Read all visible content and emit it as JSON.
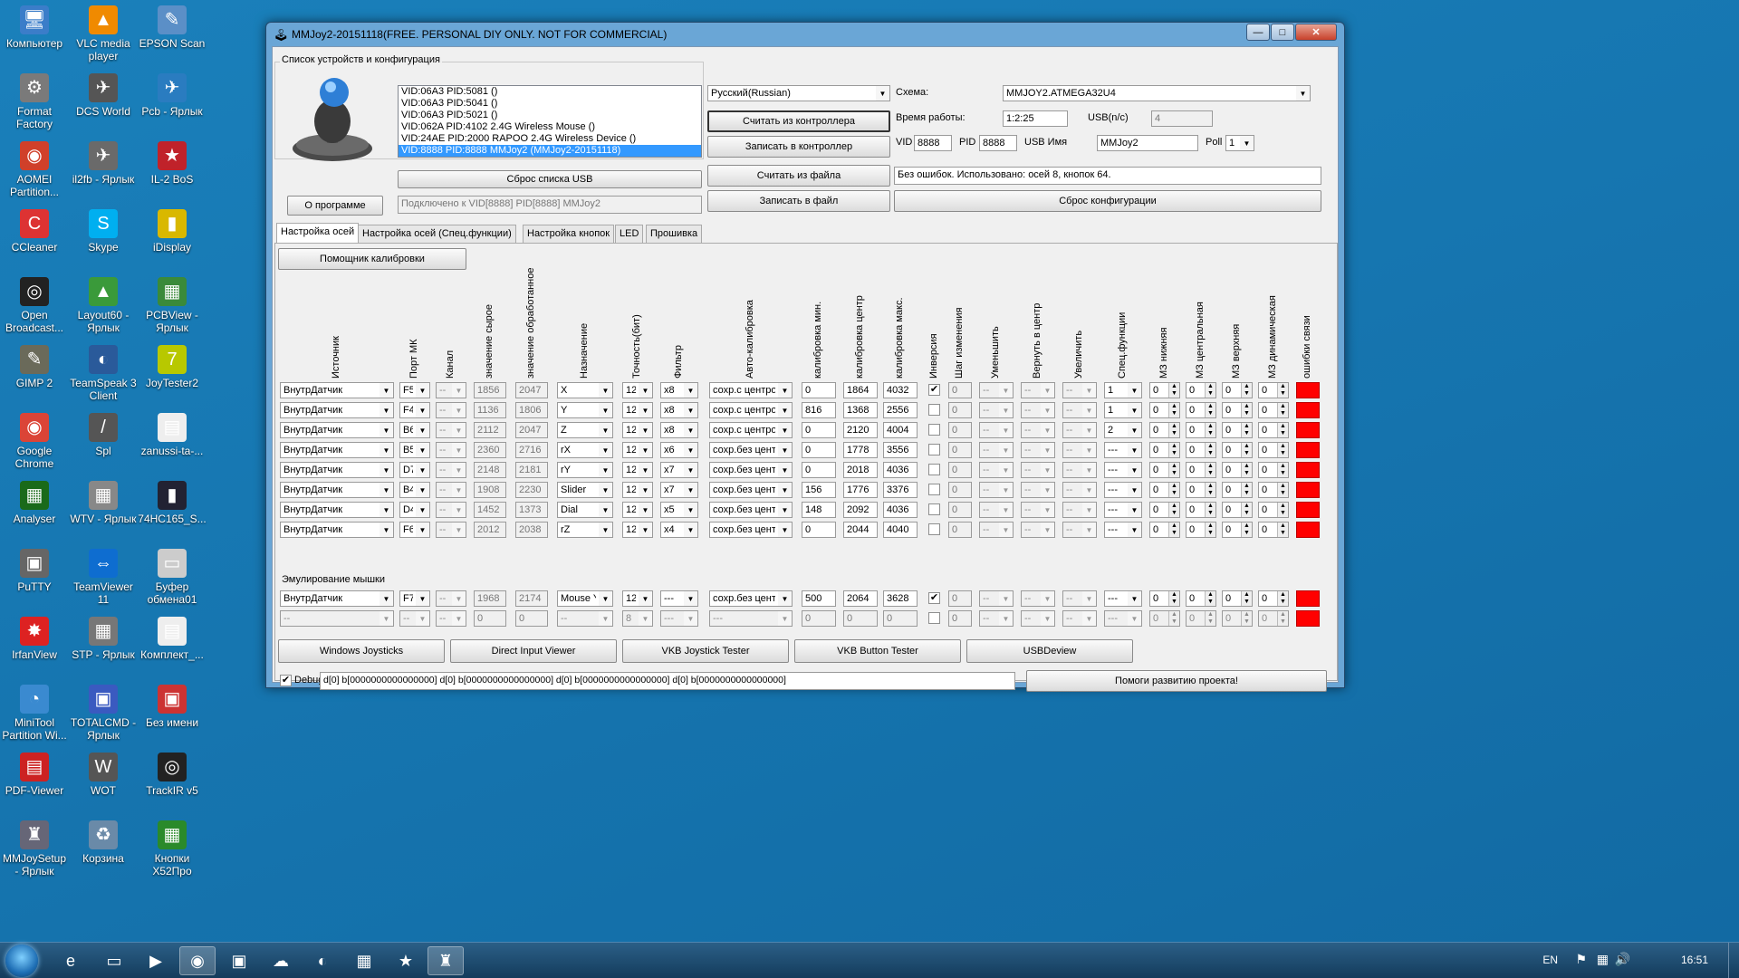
{
  "desktop_icons": [
    {
      "label": "Компьютер",
      "icon": "computer-icon",
      "glyph": "🖥",
      "color": "#3b7dc9"
    },
    {
      "label": "VLC media player",
      "icon": "vlc-icon",
      "glyph": "▲",
      "color": "#f08a00"
    },
    {
      "label": "EPSON Scan",
      "icon": "scanner-icon",
      "glyph": "✎",
      "color": "#5b8fc7"
    },
    {
      "label": "Format Factory",
      "icon": "format-factory-icon",
      "glyph": "⚙",
      "color": "#7a7a7a"
    },
    {
      "label": "DCS World",
      "icon": "dcs-icon",
      "glyph": "✈",
      "color": "#555"
    },
    {
      "label": "Pcb - Ярлык",
      "icon": "pcb-icon",
      "glyph": "✈",
      "color": "#2a7cc0"
    },
    {
      "label": "AOMEI Partition...",
      "icon": "aomei-icon",
      "glyph": "◉",
      "color": "#d0402a"
    },
    {
      "label": "il2fb - Ярлык",
      "icon": "il2fb-icon",
      "glyph": "✈",
      "color": "#6a6a6a"
    },
    {
      "label": "IL-2 BoS",
      "icon": "il2-bos-icon",
      "glyph": "★",
      "color": "#c0222a"
    },
    {
      "label": "CCleaner",
      "icon": "ccleaner-icon",
      "glyph": "C",
      "color": "#d33"
    },
    {
      "label": "Skype",
      "icon": "skype-icon",
      "glyph": "S",
      "color": "#00aff0"
    },
    {
      "label": "iDisplay",
      "icon": "idisplay-icon",
      "glyph": "▮",
      "color": "#d9b800"
    },
    {
      "label": "Open Broadcast...",
      "icon": "obs-icon",
      "glyph": "◎",
      "color": "#222"
    },
    {
      "label": "Layout60 - Ярлык",
      "icon": "layout-icon",
      "glyph": "▲",
      "color": "#3a9a3a"
    },
    {
      "label": "PCBView - Ярлык",
      "icon": "pcbview-icon",
      "glyph": "▦",
      "color": "#3a8a3a"
    },
    {
      "label": "GIMP 2",
      "icon": "gimp-icon",
      "glyph": "✎",
      "color": "#6a6a5a"
    },
    {
      "label": "TeamSpeak 3 Client",
      "icon": "teamspeak-icon",
      "glyph": "◐",
      "color": "#2a5a9a"
    },
    {
      "label": "JoyTester2",
      "icon": "joytester-icon",
      "glyph": "7",
      "color": "#b8c800"
    },
    {
      "label": "Google Chrome",
      "icon": "chrome-icon",
      "glyph": "◉",
      "color": "#db4437"
    },
    {
      "label": "Spl",
      "icon": "spl-icon",
      "glyph": "/",
      "color": "#555"
    },
    {
      "label": "zanussi-ta-...",
      "icon": "document-icon",
      "glyph": "▤",
      "color": "#eee"
    },
    {
      "label": "Analyser",
      "icon": "analyser-icon",
      "glyph": "▦",
      "color": "#1a6a1a"
    },
    {
      "label": "WTV - Ярлык",
      "icon": "wtv-icon",
      "glyph": "▦",
      "color": "#888"
    },
    {
      "label": "74HC165_S...",
      "icon": "chip-icon",
      "glyph": "▮",
      "color": "#223"
    },
    {
      "label": "PuTTY",
      "icon": "putty-icon",
      "glyph": "▣",
      "color": "#666"
    },
    {
      "label": "TeamViewer 11",
      "icon": "teamviewer-icon",
      "glyph": "⇔",
      "color": "#0e6dd0"
    },
    {
      "label": "Буфер обмена01",
      "icon": "clipboard-icon",
      "glyph": "▭",
      "color": "#ccc"
    },
    {
      "label": "IrfanView",
      "icon": "irfanview-icon",
      "glyph": "✸",
      "color": "#d22"
    },
    {
      "label": "STP - Ярлык",
      "icon": "stp-icon",
      "glyph": "▦",
      "color": "#777"
    },
    {
      "label": "Комплект_...",
      "icon": "document-icon",
      "glyph": "▤",
      "color": "#eee"
    },
    {
      "label": "MiniTool Partition Wi...",
      "icon": "minitool-icon",
      "glyph": "◔",
      "color": "#3a8ad0"
    },
    {
      "label": "TOTALCMD - Ярлык",
      "icon": "totalcmd-icon",
      "glyph": "▣",
      "color": "#3a5ac0"
    },
    {
      "label": "Без имени",
      "icon": "image-icon",
      "glyph": "▣",
      "color": "#c33"
    },
    {
      "label": "PDF-Viewer",
      "icon": "pdf-icon",
      "glyph": "▤",
      "color": "#c22"
    },
    {
      "label": "WOT",
      "icon": "wot-icon",
      "glyph": "W",
      "color": "#555"
    },
    {
      "label": "TrackIR v5",
      "icon": "trackir-icon",
      "glyph": "◎",
      "color": "#222"
    },
    {
      "label": "MMJoySetup - Ярлык",
      "icon": "joystick-icon",
      "glyph": "♜",
      "color": "#667"
    },
    {
      "label": "Корзина",
      "icon": "recycle-bin-icon",
      "glyph": "♻",
      "color": "#6a8aa8"
    },
    {
      "label": "Кнопки X52Про",
      "icon": "spreadsheet-icon",
      "glyph": "▦",
      "color": "#2a8a2a"
    }
  ],
  "window": {
    "title": "MMJoy2-20151118(FREE. PERSONAL DIY ONLY. NOT FOR COMMERCIAL)",
    "group_title": "Список устройств и конфигурация",
    "devices": [
      "VID:06A3 PID:5081  ()",
      "VID:06A3 PID:5041  ()",
      "VID:06A3 PID:5021  ()",
      "VID:062A PID:4102 2.4G Wireless Mouse ()",
      "VID:24AE PID:2000 RAPOO 2.4G Wireless Device ()",
      "VID:8888 PID:8888 MMJoy2 (MMJoy2-20151118)"
    ],
    "about_button": "О программе",
    "reset_usb_button": "Сброс списка USB",
    "connected_text": "Подключено к VID[8888] PID[8888] MMJoy2",
    "language": "Русский(Russian)",
    "read_controller": "Считать из контроллера",
    "write_controller": "Записать в контроллер",
    "read_file": "Считать из файла",
    "write_file": "Записать в файл",
    "scheme_label": "Схема:",
    "scheme_value": "MMJOY2.ATMEGA32U4",
    "uptime_label": "Время работы:",
    "uptime_value": "1:2:25",
    "usb_label": "USB(n/c)",
    "usb_value": "4",
    "vid_label": "VID",
    "vid_value": "8888",
    "pid_label": "PID",
    "pid_value": "8888",
    "usb_name_label": "USB Имя",
    "usb_name_value": "MMJoy2",
    "poll_label": "Poll",
    "poll_value": "1",
    "status_text": "Без ошибок. Использовано: осей  8, кнопок  64.",
    "reset_config_button": "Сброс конфигурации",
    "tabs": [
      "Настройка осей",
      "Настройка осей (Спец.функции)",
      "Настройка кнопок",
      "LED",
      "Прошивка"
    ],
    "calib_helper": "Помощник калибровки",
    "col_headers": [
      "Источник",
      "Порт МК",
      "Канал",
      "значение сырое",
      "значение обработанное",
      "Назначение",
      "Точность(бит)",
      "Фильтр",
      "Авто-калибровка",
      "калибровка мин.",
      "калибровка центр",
      "калибровка макс.",
      "Инверсия",
      "Шаг изменения",
      "Уменьшить",
      "Вернуть в центр",
      "Увеличить",
      "Спец.функции",
      "МЗ нижняя",
      "МЗ центральная",
      "МЗ верхняя",
      "МЗ динамическая",
      "ошибки связи"
    ],
    "axis_rows": [
      {
        "src": "ВнутрДатчик",
        "port": "F5",
        "ch": "--",
        "raw": "1856",
        "proc": "2047",
        "assign": "X",
        "prec": "12",
        "filter": "x8",
        "auto": "сохр.с центром",
        "min": "0",
        "center": "1864",
        "max": "4032",
        "inv": "✔",
        "step": "0",
        "dec": "--",
        "ret": "--",
        "inc": "--",
        "spec": "1",
        "dzl": "0",
        "dzc": "0",
        "dzu": "0",
        "dzd": "0"
      },
      {
        "src": "ВнутрДатчик",
        "port": "F4",
        "ch": "--",
        "raw": "1136",
        "proc": "1806",
        "assign": "Y",
        "prec": "12",
        "filter": "x8",
        "auto": "сохр.с центром",
        "min": "816",
        "center": "1368",
        "max": "2556",
        "inv": "",
        "step": "0",
        "dec": "--",
        "ret": "--",
        "inc": "--",
        "spec": "1",
        "dzl": "0",
        "dzc": "0",
        "dzu": "0",
        "dzd": "0"
      },
      {
        "src": "ВнутрДатчик",
        "port": "B6",
        "ch": "--",
        "raw": "2112",
        "proc": "2047",
        "assign": "Z",
        "prec": "12",
        "filter": "x8",
        "auto": "сохр.с центром",
        "min": "0",
        "center": "2120",
        "max": "4004",
        "inv": "",
        "step": "0",
        "dec": "--",
        "ret": "--",
        "inc": "--",
        "spec": "2",
        "dzl": "0",
        "dzc": "0",
        "dzu": "0",
        "dzd": "0"
      },
      {
        "src": "ВнутрДатчик",
        "port": "B5",
        "ch": "--",
        "raw": "2360",
        "proc": "2716",
        "assign": "rX",
        "prec": "12",
        "filter": "x6",
        "auto": "сохр.без центра",
        "min": "0",
        "center": "1778",
        "max": "3556",
        "inv": "",
        "step": "0",
        "dec": "--",
        "ret": "--",
        "inc": "--",
        "spec": "---",
        "dzl": "0",
        "dzc": "0",
        "dzu": "0",
        "dzd": "0"
      },
      {
        "src": "ВнутрДатчик",
        "port": "D7",
        "ch": "--",
        "raw": "2148",
        "proc": "2181",
        "assign": "rY",
        "prec": "12",
        "filter": "x7",
        "auto": "сохр.без центра",
        "min": "0",
        "center": "2018",
        "max": "4036",
        "inv": "",
        "step": "0",
        "dec": "--",
        "ret": "--",
        "inc": "--",
        "spec": "---",
        "dzl": "0",
        "dzc": "0",
        "dzu": "0",
        "dzd": "0"
      },
      {
        "src": "ВнутрДатчик",
        "port": "B4",
        "ch": "--",
        "raw": "1908",
        "proc": "2230",
        "assign": "Slider",
        "prec": "12",
        "filter": "x7",
        "auto": "сохр.без центра",
        "min": "156",
        "center": "1776",
        "max": "3376",
        "inv": "",
        "step": "0",
        "dec": "--",
        "ret": "--",
        "inc": "--",
        "spec": "---",
        "dzl": "0",
        "dzc": "0",
        "dzu": "0",
        "dzd": "0"
      },
      {
        "src": "ВнутрДатчик",
        "port": "D4",
        "ch": "--",
        "raw": "1452",
        "proc": "1373",
        "assign": "Dial",
        "prec": "12",
        "filter": "x5",
        "auto": "сохр.без центра",
        "min": "148",
        "center": "2092",
        "max": "4036",
        "inv": "",
        "step": "0",
        "dec": "--",
        "ret": "--",
        "inc": "--",
        "spec": "---",
        "dzl": "0",
        "dzc": "0",
        "dzu": "0",
        "dzd": "0"
      },
      {
        "src": "ВнутрДатчик",
        "port": "F6",
        "ch": "--",
        "raw": "2012",
        "proc": "2038",
        "assign": "rZ",
        "prec": "12",
        "filter": "x4",
        "auto": "сохр.без центра",
        "min": "0",
        "center": "2044",
        "max": "4040",
        "inv": "",
        "step": "0",
        "dec": "--",
        "ret": "--",
        "inc": "--",
        "spec": "---",
        "dzl": "0",
        "dzc": "0",
        "dzu": "0",
        "dzd": "0"
      }
    ],
    "mouse_label": "Эмулирование мышки",
    "mouse_rows": [
      {
        "src": "ВнутрДатчик",
        "port": "F7",
        "ch": "--",
        "raw": "1968",
        "proc": "2174",
        "assign": "Mouse Y",
        "prec": "12",
        "filter": "---",
        "auto": "сохр.без центра",
        "min": "500",
        "center": "2064",
        "max": "3628",
        "inv": "✔",
        "step": "0",
        "dec": "--",
        "ret": "--",
        "inc": "--",
        "spec": "---",
        "dzl": "0",
        "dzc": "0",
        "dzu": "0",
        "dzd": "0"
      },
      {
        "src": "--",
        "port": "--",
        "ch": "--",
        "raw": "0",
        "proc": "0",
        "assign": "--",
        "prec": "8",
        "filter": "---",
        "auto": "---",
        "min": "0",
        "center": "0",
        "max": "0",
        "inv": "",
        "step": "0",
        "dec": "--",
        "ret": "--",
        "inc": "--",
        "spec": "---",
        "dzl": "0",
        "dzc": "0",
        "dzu": "0",
        "dzd": "0"
      }
    ],
    "bottom_buttons": [
      "Windows Joysticks",
      "Direct Input Viewer",
      "VKB Joystick Tester",
      "VKB Button Tester",
      "USBDeview"
    ],
    "debug_label": "Debug",
    "debug_text": "d[0] b[0000000000000000]   d[0] b[0000000000000000]   d[0] b[0000000000000000]   d[0] b[0000000000000000]",
    "help_button": "Помоги развитию проекта!",
    "error_color": "#ff0000"
  },
  "taskbar": {
    "items": [
      "ie-icon",
      "explorer-icon",
      "media-player-icon",
      "chrome-icon",
      "totalcmd-icon",
      "cloud-icon",
      "teamspeak-icon",
      "calculator-icon",
      "il2-bos-icon",
      "mmjoy-icon"
    ],
    "glyphs": [
      "e",
      "▭",
      "▶",
      "◉",
      "▣",
      "☁",
      "◐",
      "▦",
      "★",
      "♜"
    ],
    "lang": "EN",
    "clock": "16:51"
  }
}
